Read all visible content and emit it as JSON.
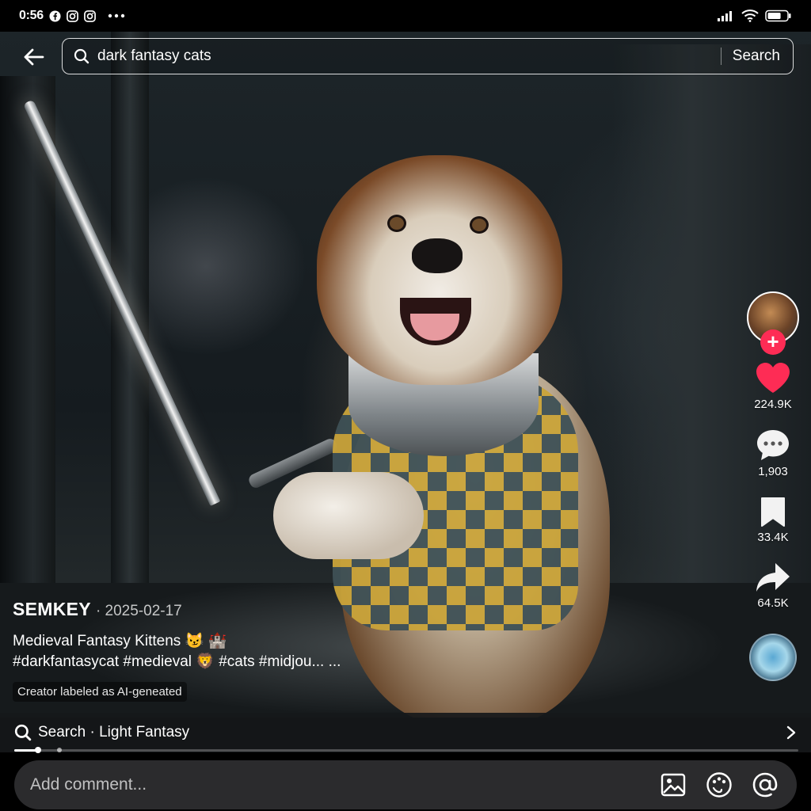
{
  "status_bar": {
    "time": "0:56",
    "battery_level": 0.7
  },
  "search": {
    "query": "dark fantasy cats",
    "button_label": "Search"
  },
  "video": {
    "author": "SEMKEY",
    "date": "· 2025-02-17",
    "title": "Medieval Fantasy Kittens 😼 🏰",
    "hashtags": "#darkfantasycat #medieval 🦁 #cats #midjou... ...",
    "ai_label": "Creator labeled as AI-geneated"
  },
  "actions": {
    "follow_symbol": "+",
    "likes": "224.9K",
    "comments": "1,903",
    "saves": "33.4K",
    "shares": "64.5K"
  },
  "related": {
    "label": "Search · Light Fantasy"
  },
  "progress": {
    "fraction": 0.03
  },
  "comment": {
    "placeholder": "Add comment..."
  },
  "colors": {
    "like": "#fe2c55",
    "follow": "#fe2c55"
  },
  "icons": [
    "back-arrow-icon",
    "search-icon",
    "heart-icon",
    "comment-bubble-icon",
    "bookmark-icon",
    "share-arrow-icon",
    "image-icon",
    "emoji-icon",
    "at-icon",
    "chevron-right-icon"
  ]
}
